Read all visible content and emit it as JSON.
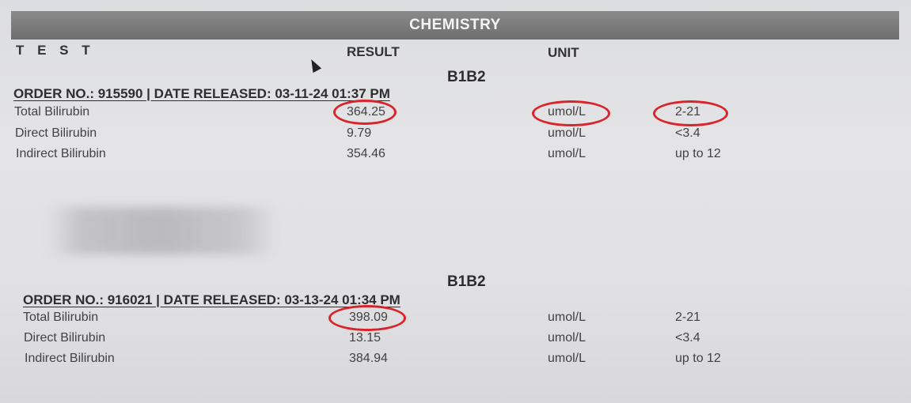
{
  "banner": {
    "title": "CHEMISTRY"
  },
  "headers": {
    "test": "T E S T",
    "result": "RESULT",
    "unit": "UNIT"
  },
  "groups": [
    {
      "title": "B1B2",
      "order_line": "ORDER NO.: 915590 | DATE RELEASED: 03-11-24 01:37 PM",
      "rows": [
        {
          "test": "Total Bilirubin",
          "result": "364.25",
          "unit": "umol/L",
          "ref": "2-21"
        },
        {
          "test": "Direct Bilirubin",
          "result": "9.79",
          "unit": "umol/L",
          "ref": "<3.4"
        },
        {
          "test": "Indirect Bilirubin",
          "result": "354.46",
          "unit": "umol/L",
          "ref": "up to 12"
        }
      ]
    },
    {
      "title": "B1B2",
      "order_line": "ORDER NO.: 916021 | DATE RELEASED: 03-13-24 01:34 PM",
      "rows": [
        {
          "test": "Total Bilirubin",
          "result": "398.09",
          "unit": "umol/L",
          "ref": "2-21"
        },
        {
          "test": "Direct Bilirubin",
          "result": "13.15",
          "unit": "umol/L",
          "ref": "<3.4"
        },
        {
          "test": "Indirect Bilirubin",
          "result": "384.94",
          "unit": "umol/L",
          "ref": "up to 12"
        }
      ]
    }
  ],
  "annotation_color": "#d8242a"
}
